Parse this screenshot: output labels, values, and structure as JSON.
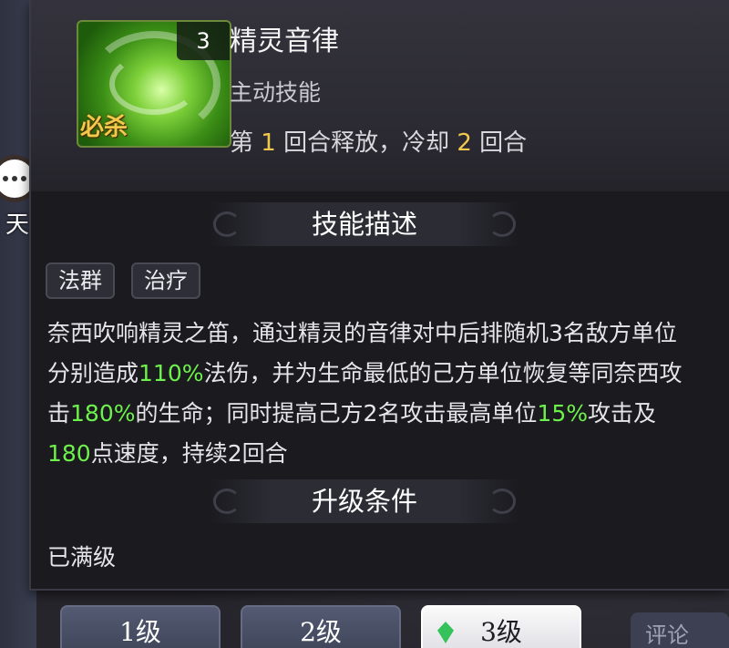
{
  "skill": {
    "name": "精灵音律",
    "type": "主动技能",
    "level_badge": "3",
    "icon_tag": "必杀",
    "cooldown": {
      "prefix": "第 ",
      "release_round": "1",
      "mid": " 回合释放，冷却 ",
      "cd_rounds": "2",
      "suffix": " 回合"
    }
  },
  "sections": {
    "description_title": "技能描述",
    "upgrade_title": "升级条件"
  },
  "tags": [
    "法群",
    "治疗"
  ],
  "description": {
    "segments": [
      {
        "text": "奈西吹响精灵之笛，通过精灵的音律对中后排随机3名敌方单位分别造成",
        "hl": false
      },
      {
        "text": "110%",
        "hl": true
      },
      {
        "text": "法伤，并为生命最低的己方单位恢复等同奈西攻击",
        "hl": false
      },
      {
        "text": "180%",
        "hl": true
      },
      {
        "text": "的生命；同时提高己方2名攻击最高单位",
        "hl": false
      },
      {
        "text": "15%",
        "hl": true
      },
      {
        "text": "攻击及",
        "hl": false
      },
      {
        "text": "180",
        "hl": true
      },
      {
        "text": "点速度，持续2回合",
        "hl": false
      }
    ]
  },
  "upgrade_status": "已满级",
  "sidebar": {
    "chat_label": "天"
  },
  "tabs": [
    {
      "label": "1级",
      "active": false
    },
    {
      "label": "2级",
      "active": false
    },
    {
      "label": "3级",
      "active": true
    }
  ],
  "comment_label": "评论",
  "colors": {
    "highlight_green": "#6cf24a",
    "number_yellow": "#f2c94c",
    "kill_tag_gold": "#f3c94c"
  }
}
